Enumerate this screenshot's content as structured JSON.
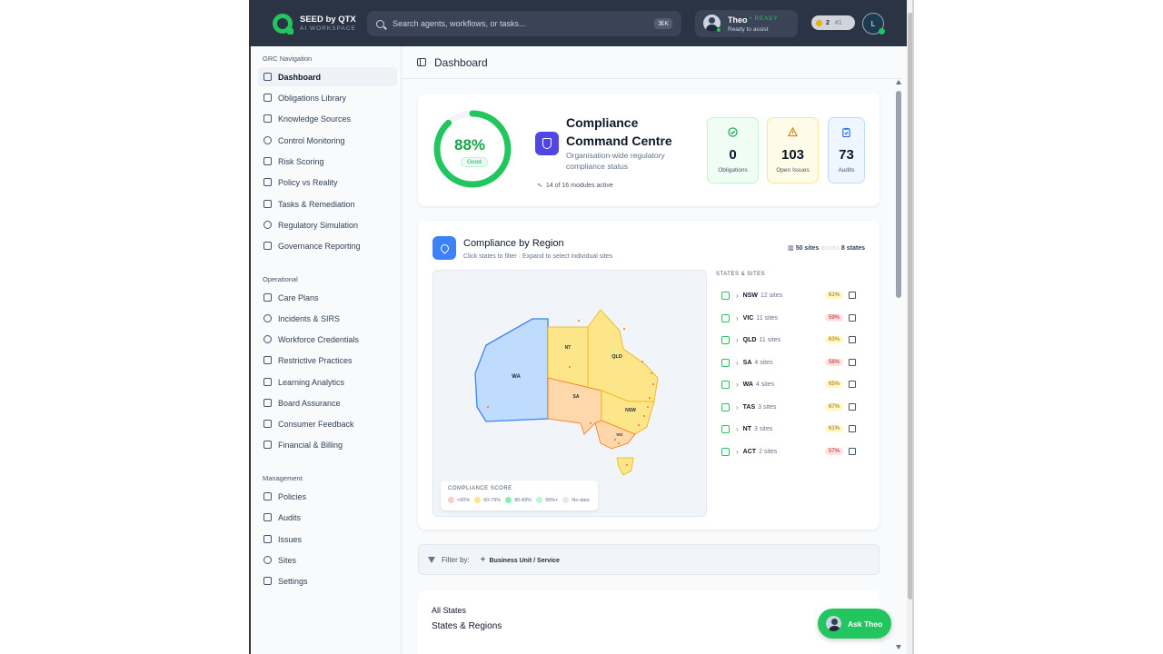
{
  "app": {
    "brand": "SEED by QTX",
    "brand_sub": "AI WORKSPACE"
  },
  "search": {
    "placeholder": "Search agents, workflows, or tasks...",
    "shortcut": "⌘K"
  },
  "user": {
    "name": "Theo",
    "ready": "• READY",
    "status": "Ready to assist"
  },
  "credits": {
    "count": "2",
    "rank": "#1"
  },
  "profile_initial": "L",
  "sidebar": {
    "sections": [
      {
        "title": "GRC Navigation",
        "items": [
          "Dashboard",
          "Obligations Library",
          "Knowledge Sources",
          "Control Monitoring",
          "Risk Scoring",
          "Policy vs Reality",
          "Tasks & Remediation",
          "Regulatory Simulation",
          "Governance Reporting"
        ]
      },
      {
        "title": "Operational",
        "items": [
          "Care Plans",
          "Incidents & SIRS",
          "Workforce Credentials",
          "Restrictive Practices",
          "Learning Analytics",
          "Board Assurance",
          "Consumer Feedback",
          "Financial & Billing"
        ]
      },
      {
        "title": "Management",
        "items": [
          "Policies",
          "Audits",
          "Issues",
          "Sites",
          "Settings"
        ]
      }
    ],
    "active": "Dashboard"
  },
  "page": {
    "title": "Dashboard"
  },
  "command_centre": {
    "score": "88%",
    "score_value": 0.88,
    "score_label": "Good",
    "title": "Compliance Command Centre",
    "subtitle": "Organisation-wide regulatory compliance status",
    "modules": "14 of 16 modules active",
    "stats": [
      {
        "value": "0",
        "label": "Obligations",
        "color": "#16a34a"
      },
      {
        "value": "103",
        "label": "Open Issues",
        "color": "#d97706"
      },
      {
        "value": "73",
        "label": "Audits",
        "color": "#2563eb"
      }
    ]
  },
  "region": {
    "title": "Compliance by Region",
    "subtitle": "Click states to filter · Expand to select individual sites",
    "sites_count": "50 sites",
    "across": "across",
    "states_count": "8 states",
    "list_title": "STATES & SITES",
    "states": [
      {
        "code": "NSW",
        "sites": "12 sites",
        "pct": "61%",
        "tone": "y"
      },
      {
        "code": "VIC",
        "sites": "11 sites",
        "pct": "59%",
        "tone": "r"
      },
      {
        "code": "QLD",
        "sites": "11 sites",
        "pct": "63%",
        "tone": "y"
      },
      {
        "code": "SA",
        "sites": "4 sites",
        "pct": "58%",
        "tone": "r"
      },
      {
        "code": "WA",
        "sites": "4 sites",
        "pct": "65%",
        "tone": "y"
      },
      {
        "code": "TAS",
        "sites": "3 sites",
        "pct": "67%",
        "tone": "y"
      },
      {
        "code": "NT",
        "sites": "3 sites",
        "pct": "61%",
        "tone": "y"
      },
      {
        "code": "ACT",
        "sites": "2 sites",
        "pct": "57%",
        "tone": "r"
      }
    ],
    "map_labels": {
      "wa": "WA",
      "nt": "NT",
      "qld": "QLD",
      "sa": "SA",
      "nsw": "NSW",
      "vic": "VIC"
    },
    "legend": {
      "title": "COMPLIANCE SCORE",
      "items": [
        {
          "label": "<60%",
          "color": "#fecaca"
        },
        {
          "label": "60-79%",
          "color": "#fde68a"
        },
        {
          "label": "80-89%",
          "color": "#86efac"
        },
        {
          "label": "90%+",
          "color": "#bbf7d0"
        },
        {
          "label": "No data",
          "color": "#e5e7eb"
        }
      ]
    }
  },
  "filter": {
    "label": "Filter by:",
    "button": "Business Unit / Service"
  },
  "bottom": {
    "all_states": "All States",
    "states_regions": "States & Regions"
  },
  "ask": {
    "label": "Ask Theo"
  },
  "colors": {
    "accent": "#22c55e",
    "topbar": "#2b3445",
    "brand_indigo": "#4f46e5"
  }
}
